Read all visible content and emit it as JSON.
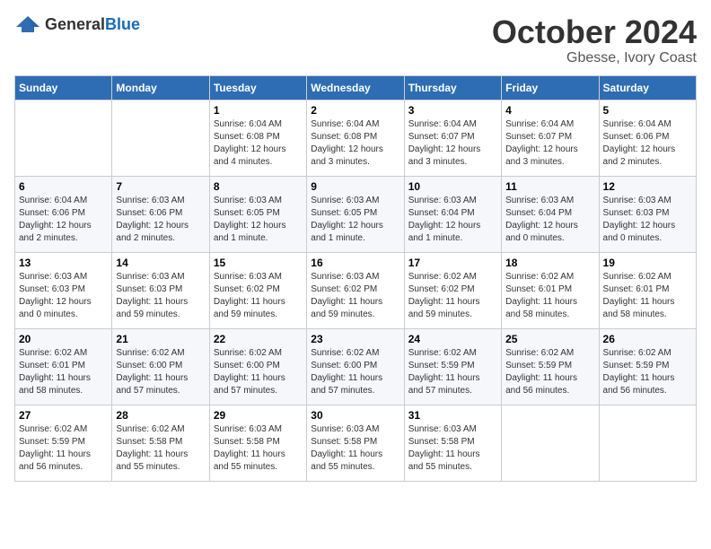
{
  "logo": {
    "text_general": "General",
    "text_blue": "Blue"
  },
  "header": {
    "month": "October 2024",
    "location": "Gbesse, Ivory Coast"
  },
  "weekdays": [
    "Sunday",
    "Monday",
    "Tuesday",
    "Wednesday",
    "Thursday",
    "Friday",
    "Saturday"
  ],
  "weeks": [
    [
      {
        "day": "",
        "info": ""
      },
      {
        "day": "",
        "info": ""
      },
      {
        "day": "1",
        "info": "Sunrise: 6:04 AM\nSunset: 6:08 PM\nDaylight: 12 hours\nand 4 minutes."
      },
      {
        "day": "2",
        "info": "Sunrise: 6:04 AM\nSunset: 6:08 PM\nDaylight: 12 hours\nand 3 minutes."
      },
      {
        "day": "3",
        "info": "Sunrise: 6:04 AM\nSunset: 6:07 PM\nDaylight: 12 hours\nand 3 minutes."
      },
      {
        "day": "4",
        "info": "Sunrise: 6:04 AM\nSunset: 6:07 PM\nDaylight: 12 hours\nand 3 minutes."
      },
      {
        "day": "5",
        "info": "Sunrise: 6:04 AM\nSunset: 6:06 PM\nDaylight: 12 hours\nand 2 minutes."
      }
    ],
    [
      {
        "day": "6",
        "info": "Sunrise: 6:04 AM\nSunset: 6:06 PM\nDaylight: 12 hours\nand 2 minutes."
      },
      {
        "day": "7",
        "info": "Sunrise: 6:03 AM\nSunset: 6:06 PM\nDaylight: 12 hours\nand 2 minutes."
      },
      {
        "day": "8",
        "info": "Sunrise: 6:03 AM\nSunset: 6:05 PM\nDaylight: 12 hours\nand 1 minute."
      },
      {
        "day": "9",
        "info": "Sunrise: 6:03 AM\nSunset: 6:05 PM\nDaylight: 12 hours\nand 1 minute."
      },
      {
        "day": "10",
        "info": "Sunrise: 6:03 AM\nSunset: 6:04 PM\nDaylight: 12 hours\nand 1 minute."
      },
      {
        "day": "11",
        "info": "Sunrise: 6:03 AM\nSunset: 6:04 PM\nDaylight: 12 hours\nand 0 minutes."
      },
      {
        "day": "12",
        "info": "Sunrise: 6:03 AM\nSunset: 6:03 PM\nDaylight: 12 hours\nand 0 minutes."
      }
    ],
    [
      {
        "day": "13",
        "info": "Sunrise: 6:03 AM\nSunset: 6:03 PM\nDaylight: 12 hours\nand 0 minutes."
      },
      {
        "day": "14",
        "info": "Sunrise: 6:03 AM\nSunset: 6:03 PM\nDaylight: 11 hours\nand 59 minutes."
      },
      {
        "day": "15",
        "info": "Sunrise: 6:03 AM\nSunset: 6:02 PM\nDaylight: 11 hours\nand 59 minutes."
      },
      {
        "day": "16",
        "info": "Sunrise: 6:03 AM\nSunset: 6:02 PM\nDaylight: 11 hours\nand 59 minutes."
      },
      {
        "day": "17",
        "info": "Sunrise: 6:02 AM\nSunset: 6:02 PM\nDaylight: 11 hours\nand 59 minutes."
      },
      {
        "day": "18",
        "info": "Sunrise: 6:02 AM\nSunset: 6:01 PM\nDaylight: 11 hours\nand 58 minutes."
      },
      {
        "day": "19",
        "info": "Sunrise: 6:02 AM\nSunset: 6:01 PM\nDaylight: 11 hours\nand 58 minutes."
      }
    ],
    [
      {
        "day": "20",
        "info": "Sunrise: 6:02 AM\nSunset: 6:01 PM\nDaylight: 11 hours\nand 58 minutes."
      },
      {
        "day": "21",
        "info": "Sunrise: 6:02 AM\nSunset: 6:00 PM\nDaylight: 11 hours\nand 57 minutes."
      },
      {
        "day": "22",
        "info": "Sunrise: 6:02 AM\nSunset: 6:00 PM\nDaylight: 11 hours\nand 57 minutes."
      },
      {
        "day": "23",
        "info": "Sunrise: 6:02 AM\nSunset: 6:00 PM\nDaylight: 11 hours\nand 57 minutes."
      },
      {
        "day": "24",
        "info": "Sunrise: 6:02 AM\nSunset: 5:59 PM\nDaylight: 11 hours\nand 57 minutes."
      },
      {
        "day": "25",
        "info": "Sunrise: 6:02 AM\nSunset: 5:59 PM\nDaylight: 11 hours\nand 56 minutes."
      },
      {
        "day": "26",
        "info": "Sunrise: 6:02 AM\nSunset: 5:59 PM\nDaylight: 11 hours\nand 56 minutes."
      }
    ],
    [
      {
        "day": "27",
        "info": "Sunrise: 6:02 AM\nSunset: 5:59 PM\nDaylight: 11 hours\nand 56 minutes."
      },
      {
        "day": "28",
        "info": "Sunrise: 6:02 AM\nSunset: 5:58 PM\nDaylight: 11 hours\nand 55 minutes."
      },
      {
        "day": "29",
        "info": "Sunrise: 6:03 AM\nSunset: 5:58 PM\nDaylight: 11 hours\nand 55 minutes."
      },
      {
        "day": "30",
        "info": "Sunrise: 6:03 AM\nSunset: 5:58 PM\nDaylight: 11 hours\nand 55 minutes."
      },
      {
        "day": "31",
        "info": "Sunrise: 6:03 AM\nSunset: 5:58 PM\nDaylight: 11 hours\nand 55 minutes."
      },
      {
        "day": "",
        "info": ""
      },
      {
        "day": "",
        "info": ""
      }
    ]
  ]
}
